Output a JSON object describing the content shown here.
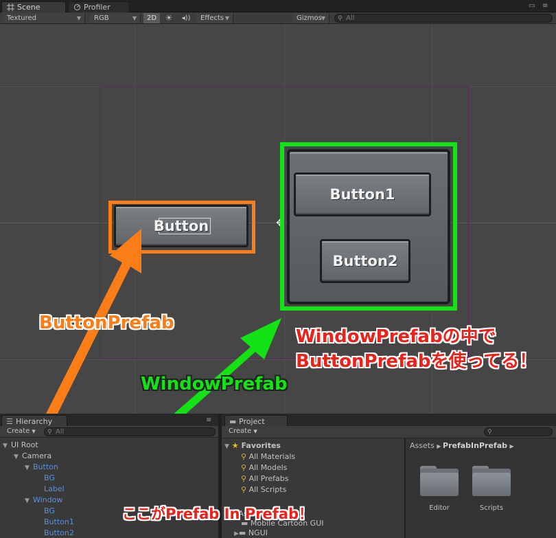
{
  "tabs": {
    "scene": "Scene",
    "profiler": "Profiler"
  },
  "toolbar": {
    "render_mode": "Textured",
    "color_mode": "RGB",
    "mode_2d": "2D",
    "effects": "Effects",
    "gizmos": "Gizmos",
    "search_placeholder": "All"
  },
  "scene": {
    "button_label": "Button",
    "window_button1": "Button1",
    "window_button2": "Button2"
  },
  "annotations": {
    "button_prefab": "ButtonPrefab",
    "window_prefab": "WindowPrefab",
    "note_line1": "WindowPrefabの中で",
    "note_line2": "ButtonPrefabを使ってる！",
    "prefab_in_prefab": "ここがPrefab In Prefab！",
    "colors": {
      "orange": "#fa7d18",
      "green": "#13e314",
      "red": "#e8231c"
    }
  },
  "hierarchy": {
    "title": "Hierarchy",
    "create": "Create",
    "search_placeholder": "All",
    "items": [
      {
        "label": "UI Root",
        "depth": 0,
        "expanded": false,
        "prefab": false
      },
      {
        "label": "Camera",
        "depth": 1,
        "expanded": true,
        "prefab": false
      },
      {
        "label": "Button",
        "depth": 2,
        "expanded": true,
        "prefab": true
      },
      {
        "label": "BG",
        "depth": 3,
        "expanded": false,
        "prefab": true
      },
      {
        "label": "Label",
        "depth": 3,
        "expanded": false,
        "prefab": true
      },
      {
        "label": "Window",
        "depth": 2,
        "expanded": true,
        "prefab": true
      },
      {
        "label": "BG",
        "depth": 3,
        "expanded": false,
        "prefab": true
      },
      {
        "label": "Button1",
        "depth": 3,
        "expanded": false,
        "prefab": true
      },
      {
        "label": "Button2",
        "depth": 3,
        "expanded": false,
        "prefab": true
      }
    ]
  },
  "project": {
    "title": "Project",
    "create": "Create",
    "favorites_label": "Favorites",
    "favorites": [
      "All Materials",
      "All Models",
      "All Prefabs",
      "All Scripts"
    ],
    "assets_label": "Assets",
    "asset_folders": [
      "Mobile Cartoon GUI",
      "NGUI"
    ],
    "breadcrumb": [
      "Assets",
      "PrefabInPrefab"
    ],
    "folders": [
      "Editor",
      "Scripts"
    ]
  }
}
